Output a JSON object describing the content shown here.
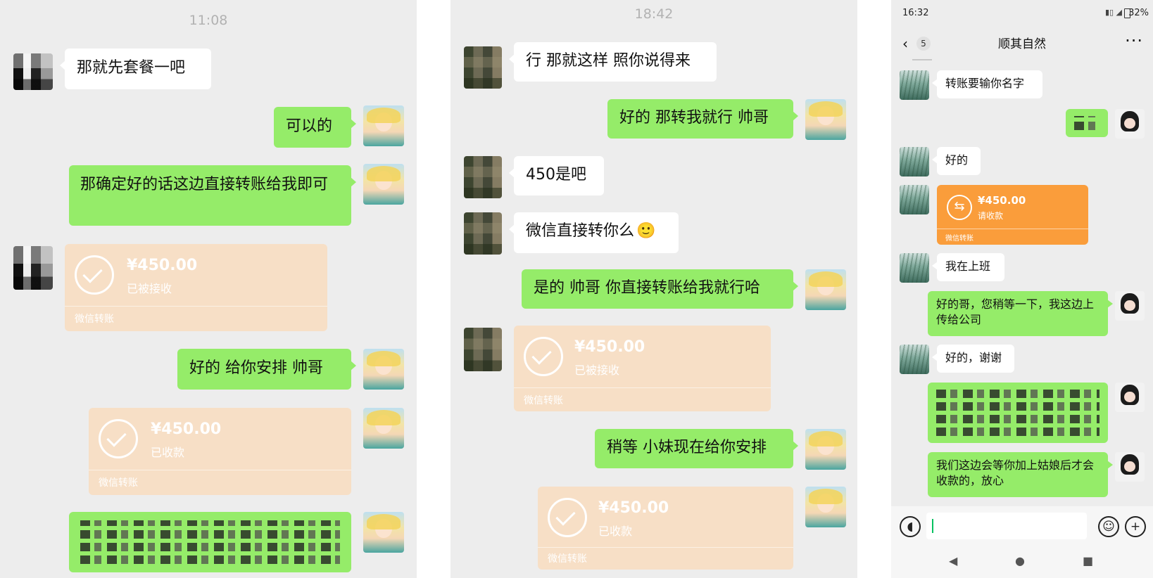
{
  "panel1": {
    "time": "11:08",
    "messages": [
      {
        "side": "left",
        "text": "那就先套餐一吧"
      },
      {
        "side": "right",
        "text": "可以的"
      },
      {
        "side": "right",
        "text": "那确定好的话这边直接转账给我即可"
      },
      {
        "side": "left",
        "type": "transfer",
        "amount": "¥450.00",
        "status": "已被接收",
        "foot": "微信转账"
      },
      {
        "side": "right",
        "text": "好的 给你安排 帅哥"
      },
      {
        "side": "right",
        "type": "transfer",
        "amount": "¥450.00",
        "status": "已收款",
        "foot": "微信转账"
      },
      {
        "side": "right",
        "type": "pixelated"
      }
    ]
  },
  "panel2": {
    "time": "18:42",
    "messages": [
      {
        "side": "left",
        "text": "行 那就这样 照你说得来"
      },
      {
        "side": "right",
        "text": "好的 那转我就行 帅哥"
      },
      {
        "side": "left",
        "text": "450是吧"
      },
      {
        "side": "left",
        "text": "微信直接转你么"
      },
      {
        "side": "right",
        "text": "是的 帅哥 你直接转账给我就行哈"
      },
      {
        "side": "left",
        "type": "transfer",
        "amount": "¥450.00",
        "status": "已被接收",
        "foot": "微信转账"
      },
      {
        "side": "right",
        "text": "稍等 小妹现在给你安排"
      },
      {
        "side": "right",
        "type": "transfer",
        "amount": "¥450.00",
        "status": "已收款",
        "foot": "微信转账"
      }
    ],
    "emoji": "🙂"
  },
  "panel3": {
    "status_time": "16:32",
    "battery": "32%",
    "title": "顺其自然",
    "back_count": "5",
    "more": "···",
    "messages": [
      {
        "side": "left",
        "text": "转账要输你名字"
      },
      {
        "side": "right",
        "type": "pixelated"
      },
      {
        "side": "left",
        "text": "好的"
      },
      {
        "side": "left",
        "type": "transfer",
        "amount": "¥450.00",
        "status": "请收款",
        "foot": "微信转账"
      },
      {
        "side": "left",
        "text": "我在上班"
      },
      {
        "side": "right",
        "text": "好的哥，您稍等一下，我这边上传给公司"
      },
      {
        "side": "left",
        "text": "好的，谢谢"
      },
      {
        "side": "right",
        "type": "pixelated"
      },
      {
        "side": "right",
        "text": "我们这边会等你加上姑娘后才会收款的，放心"
      }
    ]
  }
}
